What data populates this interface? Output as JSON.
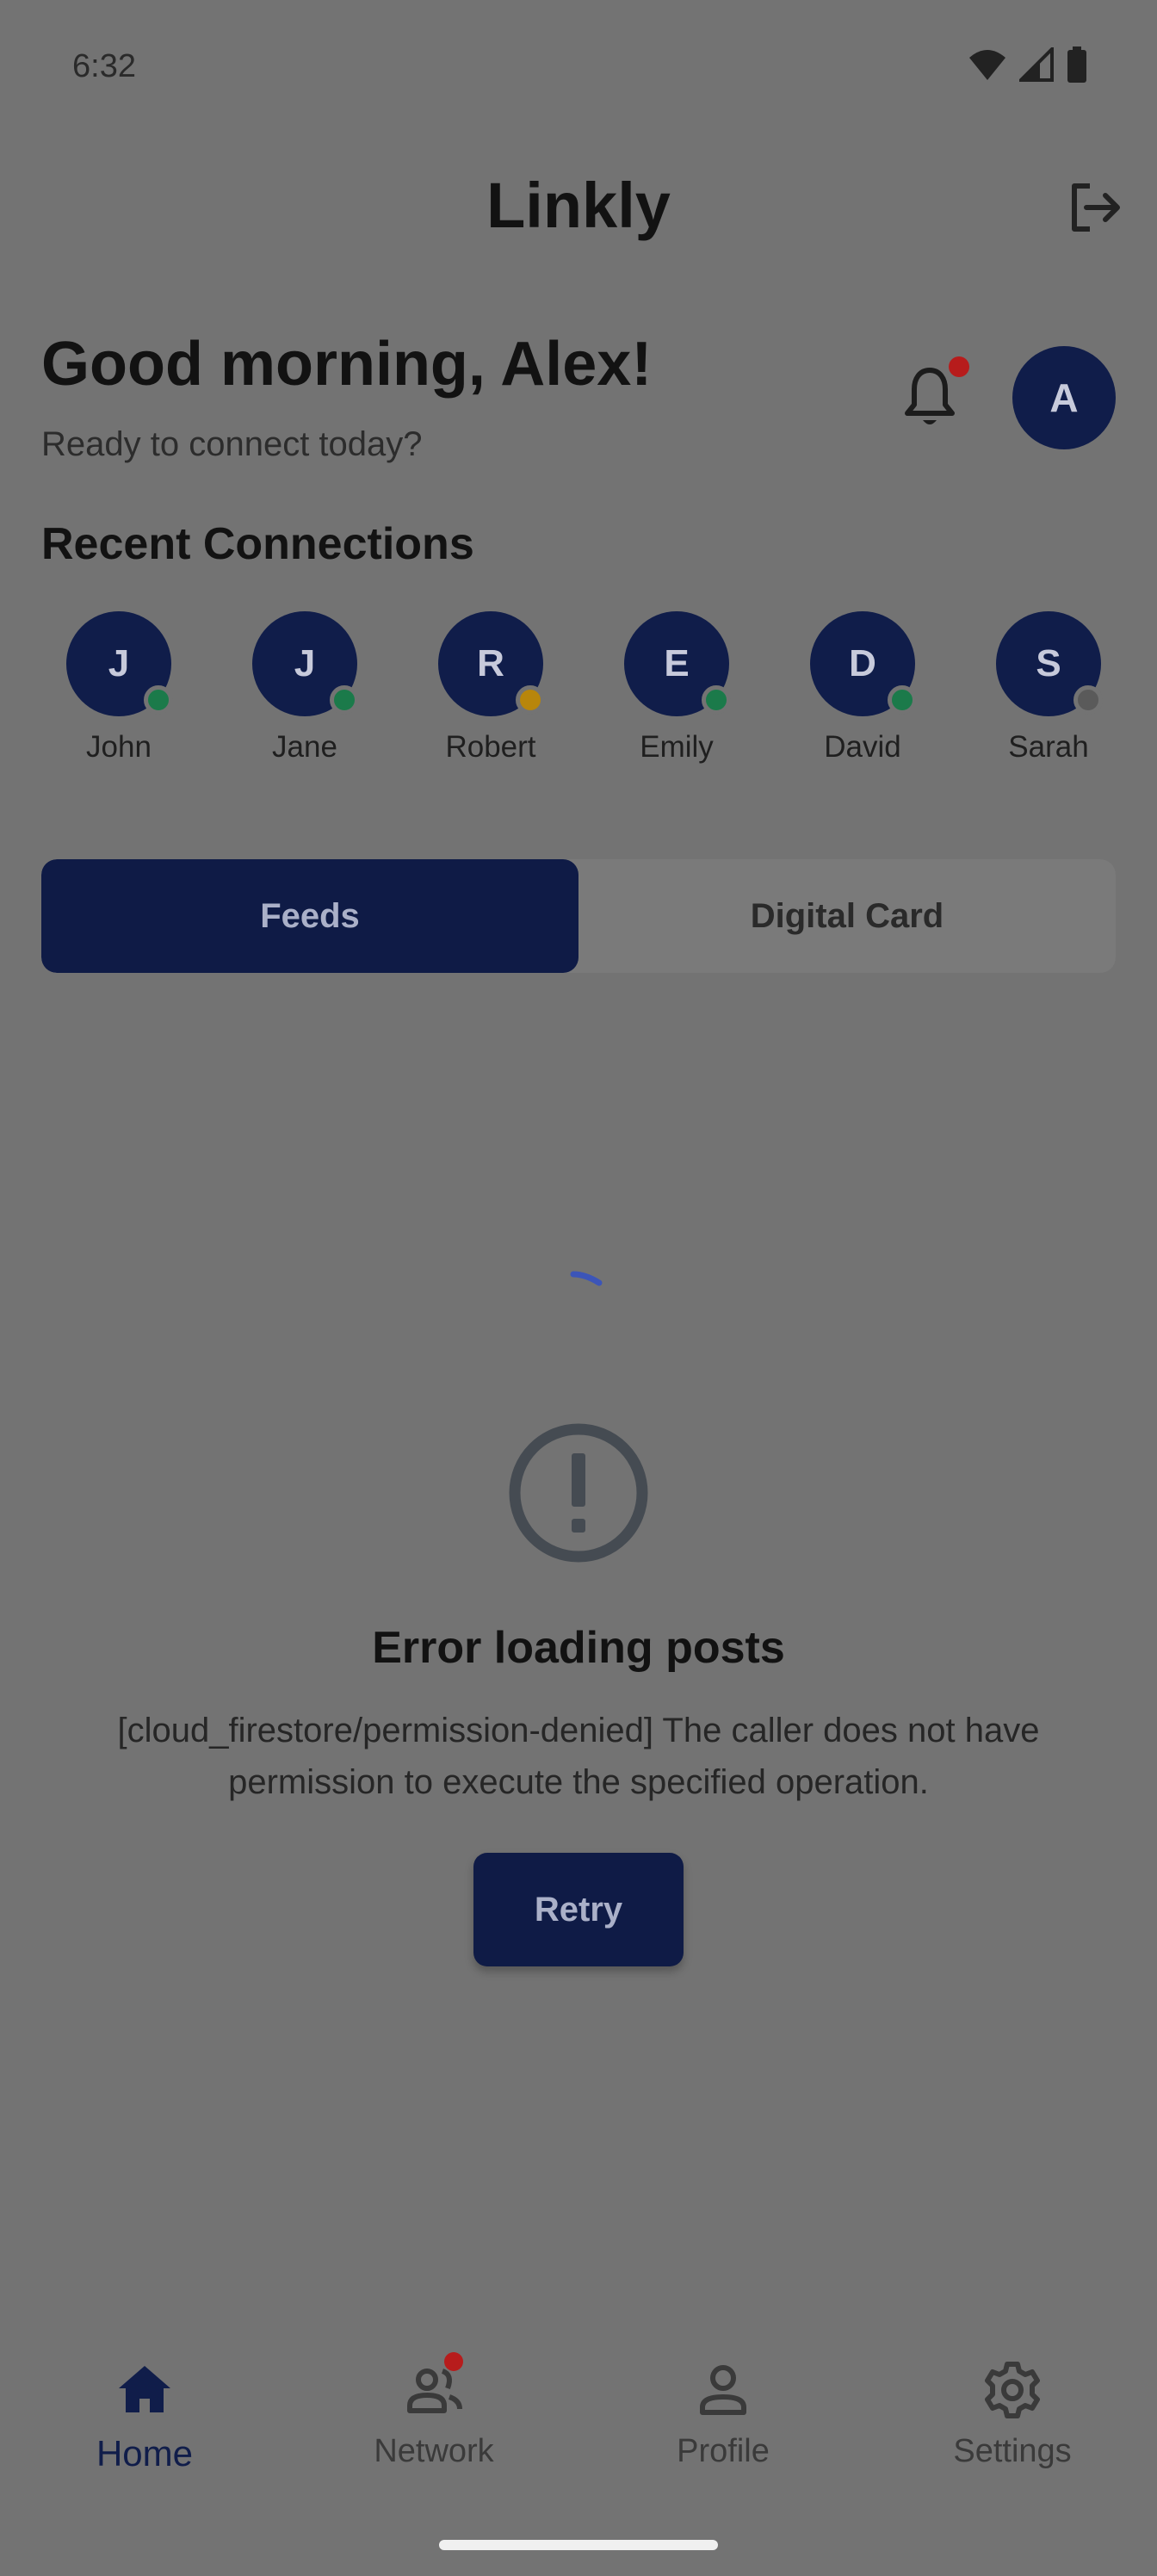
{
  "status": {
    "time": "6:32"
  },
  "app": {
    "title": "Linkly"
  },
  "greeting": {
    "title": "Good morning, Alex!",
    "subtitle": "Ready to connect today?",
    "avatar_initial": "A"
  },
  "recent": {
    "title": "Recent Connections",
    "items": [
      {
        "initial": "J",
        "name": "John",
        "status": "online",
        "status_color": "#1b7a4a"
      },
      {
        "initial": "J",
        "name": "Jane",
        "status": "online",
        "status_color": "#1b7a4a"
      },
      {
        "initial": "R",
        "name": "Robert",
        "status": "away",
        "status_color": "#b8860b"
      },
      {
        "initial": "E",
        "name": "Emily",
        "status": "online",
        "status_color": "#1b7a4a"
      },
      {
        "initial": "D",
        "name": "David",
        "status": "online",
        "status_color": "#1b7a4a"
      },
      {
        "initial": "S",
        "name": "Sarah",
        "status": "offline",
        "status_color": "#5a5a5a"
      }
    ]
  },
  "tabs": [
    {
      "label": "Feeds",
      "active": true
    },
    {
      "label": "Digital Card",
      "active": false
    }
  ],
  "error": {
    "title": "Error loading posts",
    "message": "[cloud_firestore/permission-denied] The caller does not have permission to execute the specified operation.",
    "retry_label": "Retry"
  },
  "nav": [
    {
      "label": "Home",
      "icon": "home-icon",
      "active": true
    },
    {
      "label": "Network",
      "icon": "people-icon",
      "active": false,
      "badge": true
    },
    {
      "label": "Profile",
      "icon": "person-icon",
      "active": false
    },
    {
      "label": "Settings",
      "icon": "gear-icon",
      "active": false
    }
  ],
  "colors": {
    "primary": "#101d4a",
    "badge": "#b71c1c",
    "scrim": "#737373"
  }
}
